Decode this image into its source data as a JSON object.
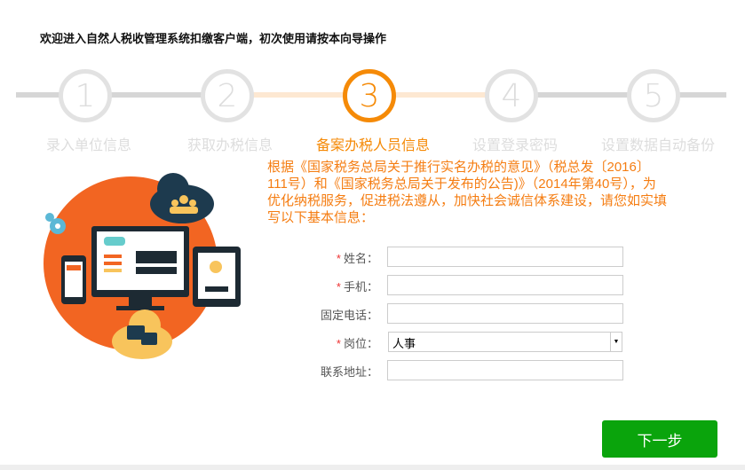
{
  "header": {
    "title": "欢迎进入自然人税收管理系统扣缴客户端，初次使用请按本向导操作"
  },
  "steps": [
    {
      "number": "1",
      "label": "录入单位信息"
    },
    {
      "number": "2",
      "label": "获取办税信息"
    },
    {
      "number": "3",
      "label": "备案办税人员信息"
    },
    {
      "number": "4",
      "label": "设置登录密码"
    },
    {
      "number": "5",
      "label": "设置数据自动备份"
    }
  ],
  "current_step": 3,
  "colors": {
    "accent": "#f58a07",
    "button": "#0aa40c"
  },
  "intro": "根据《国家税务总局关于推行实名办税的意见》（税总发〔2016〕111号）和《国家税务总局关于发布的公告)》（2014年第40号），为优化纳税服务，促进税法遵从，加快社会诚信体系建设，请您如实填写以下基本信息：",
  "form": {
    "required_mark": "*",
    "name_label": "姓名：",
    "name_value": "",
    "phone_label": "手机：",
    "phone_value": "",
    "landline_label": "固定电话：",
    "landline_value": "",
    "position_label": "岗位：",
    "position_value": "人事",
    "address_label": "联系地址：",
    "address_value": ""
  },
  "next_button": "下一步"
}
